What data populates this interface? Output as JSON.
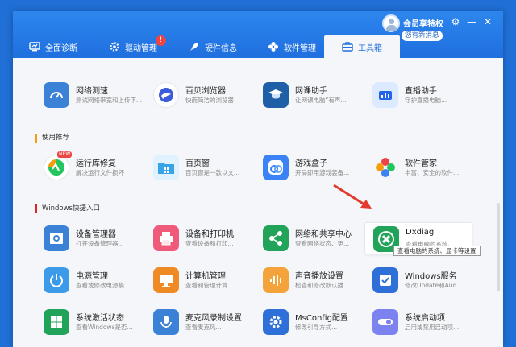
{
  "header": {
    "user_name": "会员享特权",
    "message_btn": "您有新消息",
    "minimize": "—",
    "close": "✕"
  },
  "tabs": [
    {
      "label": "全面诊断"
    },
    {
      "label": "驱动管理",
      "badge": "!"
    },
    {
      "label": "硬件信息"
    },
    {
      "label": "软件管理"
    },
    {
      "label": "工具箱"
    }
  ],
  "sections": {
    "recommended": "使用推荐",
    "windows": "Windows快捷入口"
  },
  "tools_top": [
    {
      "title": "网络测速",
      "desc": "测试网络带宽和上传下..."
    },
    {
      "title": "百贝浏览器",
      "desc": "快而简洁的浏览器"
    },
    {
      "title": "网课助手",
      "desc": "让网课电脑“有声..."
    },
    {
      "title": "直播助手",
      "desc": "守护直播电脑..."
    }
  ],
  "tools_recommended": [
    {
      "title": "运行库修复",
      "desc": "解决运行文件损坏",
      "badge": "NEW"
    },
    {
      "title": "百页窗",
      "desc": "百页窗是一款以文..."
    },
    {
      "title": "游戏盒子",
      "desc": "开局即用游戏装备..."
    },
    {
      "title": "软件管家",
      "desc": "丰富、安全的软件..."
    }
  ],
  "tools_windows_row1": [
    {
      "title": "设备管理器",
      "desc": "打开设备管理器..."
    },
    {
      "title": "设备和打印机",
      "desc": "查看设备和打印..."
    },
    {
      "title": "网络和共享中心",
      "desc": "查看网络状态、更..."
    },
    {
      "title": "Dxdiag",
      "desc": "查看电脑的系统、..."
    }
  ],
  "tools_windows_row2": [
    {
      "title": "电源管理",
      "desc": "查看或修改电源模..."
    },
    {
      "title": "计算机管理",
      "desc": "查看和管理计算..."
    },
    {
      "title": "声音播放设置",
      "desc": "检查和修改默认播..."
    },
    {
      "title": "Windows服务",
      "desc": "修改Update和Aud..."
    }
  ],
  "tools_windows_row3": [
    {
      "title": "系统激活状态",
      "desc": "查看Windows是否..."
    },
    {
      "title": "麦克风录制设置",
      "desc": "查看麦克风..."
    },
    {
      "title": "MsConfig配置",
      "desc": "修改引导方式..."
    },
    {
      "title": "系统启动项",
      "desc": "启用或禁用启动项..."
    }
  ],
  "tooltip": "查看电脑的系统、显卡等设置",
  "colors": {
    "brand": "#1f6fde",
    "accent_orange": "#f59e0b",
    "accent_red": "#dc2626"
  }
}
